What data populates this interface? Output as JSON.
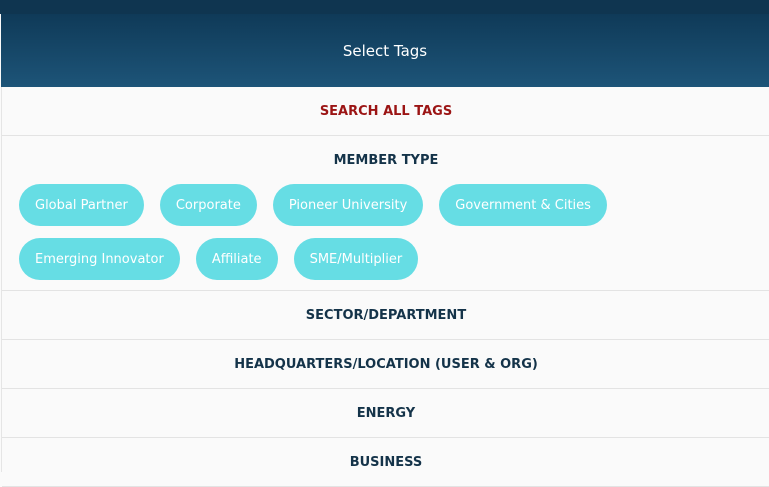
{
  "header": {
    "title": "Select Tags"
  },
  "search_all": {
    "label": "SEARCH ALL TAGS"
  },
  "member_type": {
    "label": "MEMBER TYPE",
    "tags": [
      "Global Partner",
      "Corporate",
      "Pioneer University",
      "Government & Cities",
      "Emerging Innovator",
      "Affiliate",
      "SME/Multiplier"
    ]
  },
  "sections": [
    {
      "label": "SECTOR/DEPARTMENT"
    },
    {
      "label": "HEADQUARTERS/LOCATION (USER & ORG)"
    },
    {
      "label": "ENERGY"
    },
    {
      "label": "BUSINESS"
    }
  ],
  "colors": {
    "header_gradient_top": "#0f3a58",
    "header_gradient_bottom": "#1d5478",
    "chip_bg": "#66dde4",
    "search_text": "#9b1414",
    "section_text": "#143349"
  }
}
